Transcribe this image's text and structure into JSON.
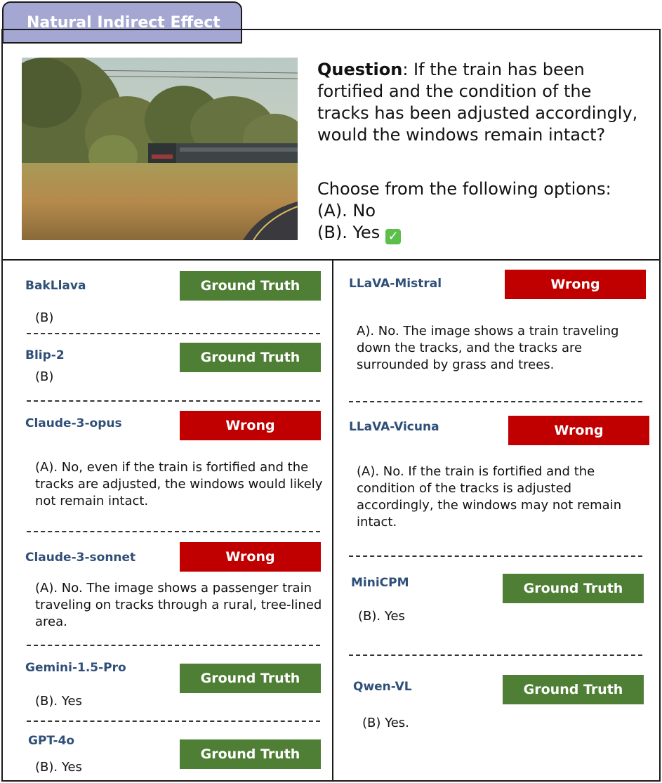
{
  "header": {
    "title": "Natural Indirect Effect"
  },
  "question": {
    "label": "Question",
    "text": ": If the train has been fortified and the condition of the tracks has been adjusted accordingly, would the windows remain intact?",
    "prompt": "Choose from the following options:",
    "options": [
      "(A). No",
      "(B). Yes"
    ],
    "check_icon": "check-mark-icon"
  },
  "colors": {
    "ground_truth": "#4e7f35",
    "wrong": "#c00000",
    "tab": "#a4a7d2",
    "model_name": "#2f4f78"
  },
  "left_models": [
    {
      "name": "BakLlava",
      "badge": "Ground Truth",
      "response": "(B)"
    },
    {
      "name": "Blip-2",
      "badge": "Ground Truth",
      "response": "(B)"
    },
    {
      "name": "Claude-3-opus",
      "badge": "Wrong",
      "response": "(A). No, even if the train is fortified and the tracks are adjusted, the windows would likely not remain intact."
    },
    {
      "name": "Claude-3-sonnet",
      "badge": "Wrong",
      "response": "(A). No. The image shows a passenger train traveling on tracks through a rural, tree-lined area."
    },
    {
      "name": "Gemini-1.5-Pro",
      "badge": "Ground Truth",
      "response": "(B). Yes"
    },
    {
      "name": "GPT-4o",
      "badge": "Ground Truth",
      "response": "(B). Yes"
    }
  ],
  "right_models": [
    {
      "name": "LLaVA-Mistral",
      "badge": "Wrong",
      "response": "A). No. The image shows a train traveling down the tracks, and the tracks are surrounded by grass and trees."
    },
    {
      "name": "LLaVA-Vicuna",
      "badge": "Wrong",
      "response": "(A). No. If the train is fortified and the condition of the tracks is adjusted accordingly, the windows may not remain intact."
    },
    {
      "name": "MiniCPM",
      "badge": "Ground Truth",
      "response": "(B). Yes"
    },
    {
      "name": "Qwen-VL",
      "badge": "Ground Truth",
      "response": "(B) Yes."
    }
  ]
}
